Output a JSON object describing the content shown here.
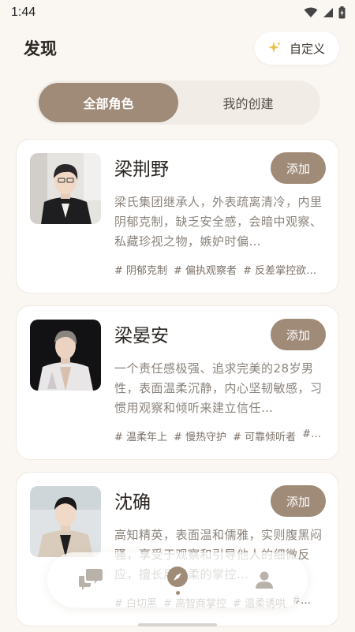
{
  "status_bar": {
    "time": "1:44"
  },
  "header": {
    "title": "发现",
    "customize_label": "自定义"
  },
  "tabs": [
    {
      "label": "全部角色",
      "active": true
    },
    {
      "label": "我的创建",
      "active": false
    }
  ],
  "characters": [
    {
      "name": "梁荆野",
      "add_label": "添加",
      "description": "梁氏集团继承人，外表疏离清冷，内里阴郁克制，缺乏安全感，会暗中观察、私藏珍视之物，嫉妒时偏…",
      "tags": [
        "# 阴郁克制",
        "# 偏执观察者",
        "# 反差掌控欲…"
      ]
    },
    {
      "name": "梁晏安",
      "add_label": "添加",
      "description": "一个责任感极强、追求完美的28岁男性，表面温柔沉静，内心坚韧敏感，习惯用观察和倾听来建立信任…",
      "tags": [
        "# 温柔年上",
        "# 慢热守护",
        "# 可靠倾听者",
        "#…"
      ]
    },
    {
      "name": "沈确",
      "add_label": "添加",
      "description": "高知精英，表面温和儒雅，实则腹黑闷骚，享受于观察和引导他人的细微反应，擅长用温柔的掌控…",
      "tags": [
        "# 白切黑",
        "# 高智商掌控",
        "# 温柔诱哄",
        "#…"
      ]
    }
  ],
  "colors": {
    "accent": "#a08b79",
    "background": "#faf7f3"
  },
  "nav": [
    {
      "icon": "chat-icon",
      "active": false
    },
    {
      "icon": "compass-icon",
      "active": true
    },
    {
      "icon": "profile-icon",
      "active": false
    }
  ]
}
